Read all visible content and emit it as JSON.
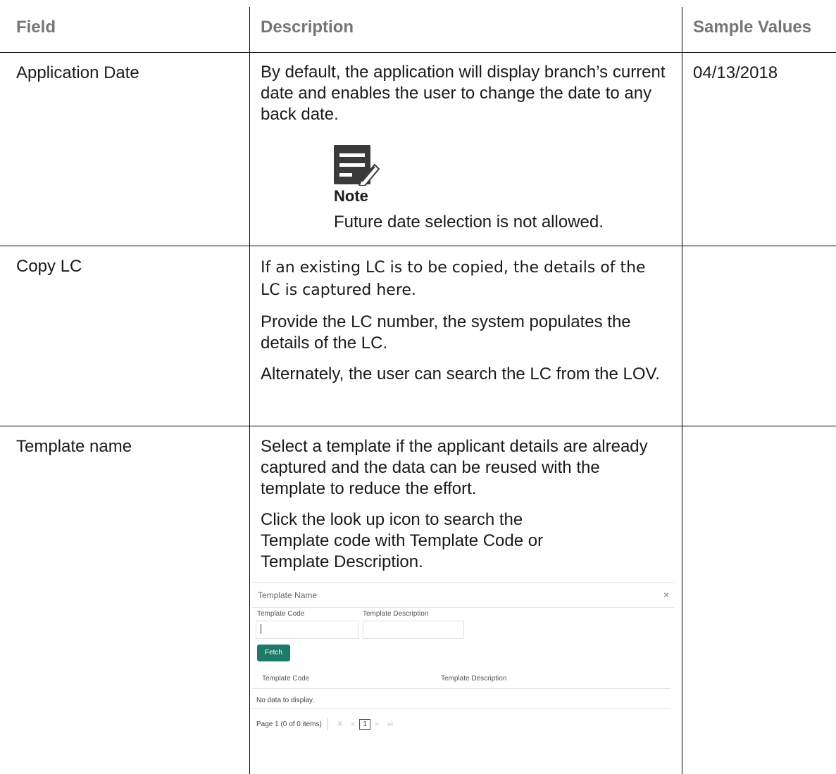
{
  "table": {
    "headers": {
      "field": "Field",
      "description": "Description",
      "sample": "Sample Values"
    },
    "rows": [
      {
        "field": "Application Date",
        "description": "By default, the application will display branch’s current date and enables the user to change the date to any back date.",
        "note_label": "Note",
        "note_text": "Future date selection is not allowed.",
        "sample": "04/13/2018"
      },
      {
        "field": "Copy LC",
        "paragraphs": [
          "If an existing LC is to be copied, the details of the LC is captured here.",
          "Provide the LC number, the system populates the details of the LC.",
          "Alternately, the user can search the LC from the LOV."
        ],
        "sample": ""
      },
      {
        "field": "Template name",
        "paragraphs": [
          "Select a template if the applicant details are already captured and the data can be reused with the template to reduce the effort.",
          "Click the look up icon to search the Template code with Template Code or Template Description."
        ],
        "sample": ""
      }
    ]
  },
  "modal": {
    "title": "Template Name",
    "close": "×",
    "code_label": "Template Code",
    "desc_label": "Template Description",
    "fetch_label": "Fetch",
    "col_code": "Template Code",
    "col_desc": "Template Description",
    "empty": "No data to display.",
    "pager_text": "Page  1  (0 of 0 items)",
    "first": "K",
    "prev": "<",
    "page": "1",
    "next": ">",
    "last": "»I"
  }
}
